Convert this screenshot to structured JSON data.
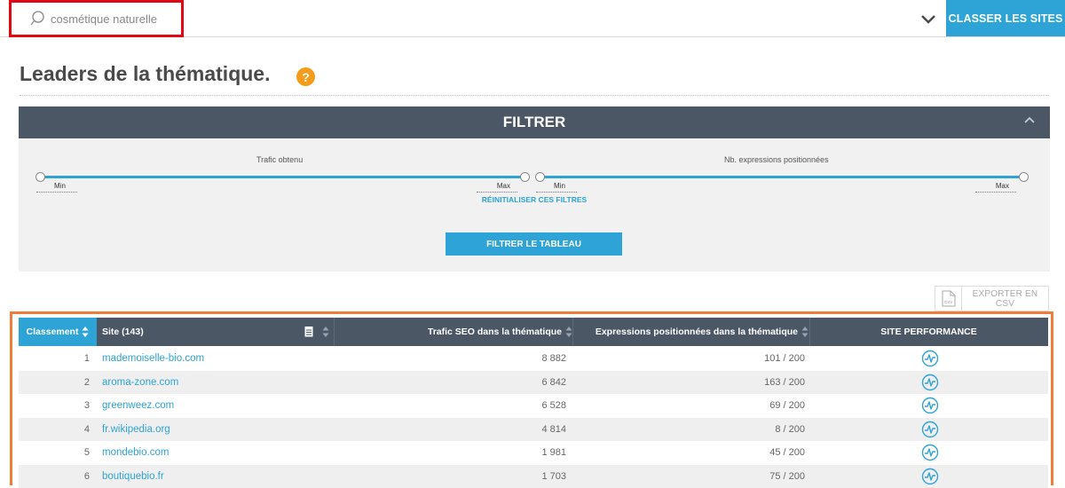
{
  "search": {
    "value": "cosmétique naturelle"
  },
  "header": {
    "classer_label": "CLASSER LES SITES"
  },
  "page": {
    "title": "Leaders de la thématique.",
    "help": "?"
  },
  "filter": {
    "title": "FILTRER",
    "traffic_label": "Trafic obtenu",
    "expressions_label": "Nb. expressions positionnées",
    "min_label": "Min",
    "max_label": "Max",
    "reset_label": "RÉINITIALISER CES FILTRES",
    "apply_label": "FILTRER LE TABLEAU"
  },
  "export": {
    "label": "EXPORTER EN CSV",
    "icon_text": "CSV"
  },
  "table": {
    "headers": {
      "rank": "Classement",
      "site": "Site (143)",
      "traffic": "Trafic SEO dans la thématique",
      "expressions": "Expressions positionnées dans la thématique",
      "performance": "SITE PERFORMANCE"
    },
    "rows": [
      {
        "rank": "1",
        "site": "mademoiselle-bio.com",
        "traffic": "8 882",
        "expressions": "101 / 200"
      },
      {
        "rank": "2",
        "site": "aroma-zone.com",
        "traffic": "6 842",
        "expressions": "163 / 200"
      },
      {
        "rank": "3",
        "site": "greenweez.com",
        "traffic": "6 528",
        "expressions": "69 / 200"
      },
      {
        "rank": "4",
        "site": "fr.wikipedia.org",
        "traffic": "4 814",
        "expressions": "8 / 200"
      },
      {
        "rank": "5",
        "site": "mondebio.com",
        "traffic": "1 981",
        "expressions": "45 / 200"
      },
      {
        "rank": "6",
        "site": "boutiquebio.fr",
        "traffic": "1 703",
        "expressions": "75 / 200"
      }
    ]
  },
  "colors": {
    "accent": "#2ea3d5",
    "header_bg": "#4c5766",
    "highlight_search": "#e30613",
    "highlight_table": "#ee7d3a",
    "help": "#f59c1a"
  }
}
